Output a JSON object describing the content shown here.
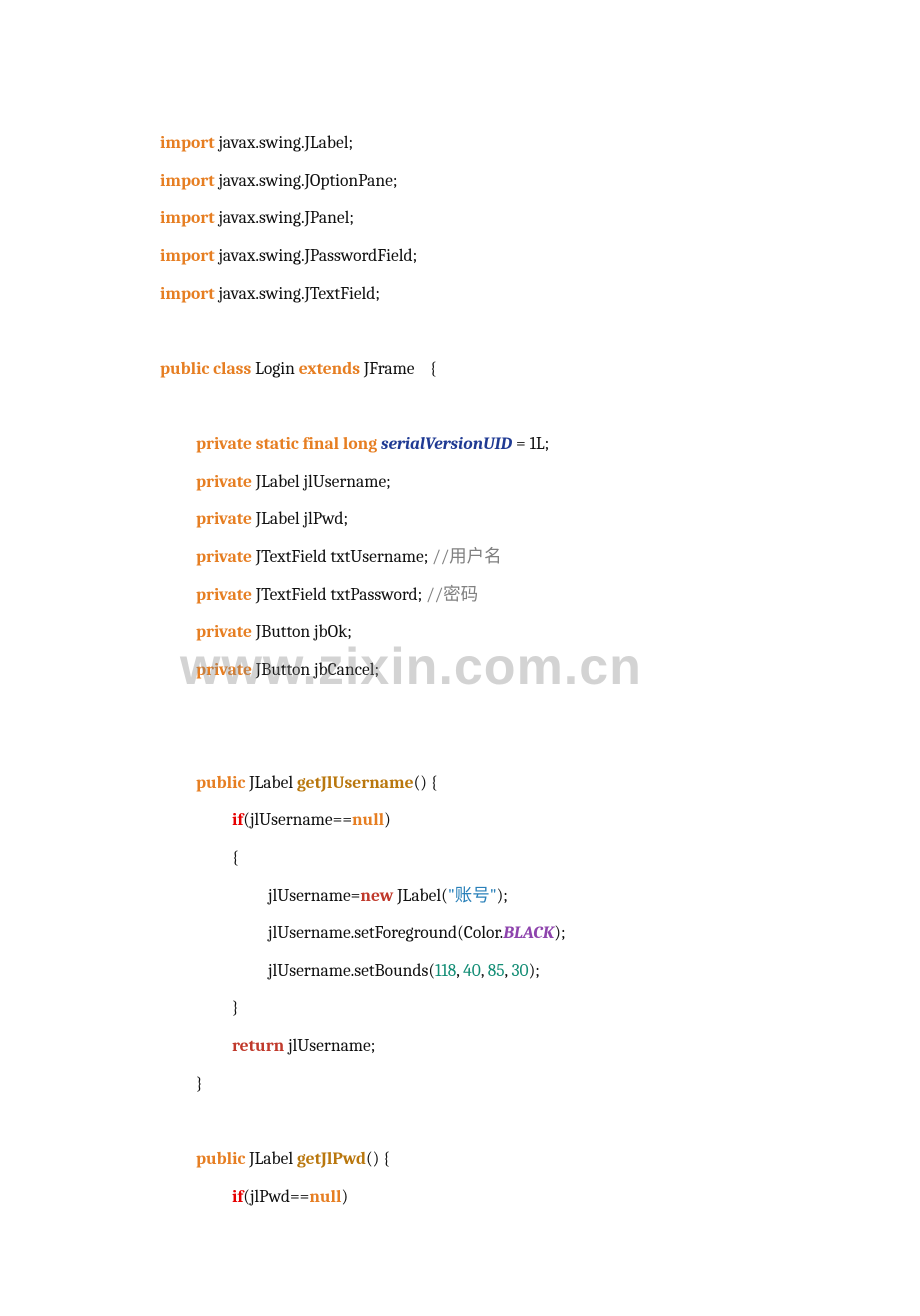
{
  "watermark": "www.zixin.com.cn",
  "lines": [
    {
      "indent": 0,
      "spans": [
        {
          "cls": "kw-orange",
          "t": "import"
        },
        {
          "cls": "txt-black",
          "t": " javax.swing.JLabel;"
        }
      ]
    },
    {
      "indent": 0,
      "spans": [
        {
          "cls": "kw-orange",
          "t": "import"
        },
        {
          "cls": "txt-black",
          "t": " javax.swing.JOptionPane;"
        }
      ]
    },
    {
      "indent": 0,
      "spans": [
        {
          "cls": "kw-orange",
          "t": "import"
        },
        {
          "cls": "txt-black",
          "t": " javax.swing.JPanel;"
        }
      ]
    },
    {
      "indent": 0,
      "spans": [
        {
          "cls": "kw-orange",
          "t": "import"
        },
        {
          "cls": "txt-black",
          "t": " javax.swing.JPasswordField;"
        }
      ]
    },
    {
      "indent": 0,
      "spans": [
        {
          "cls": "kw-orange",
          "t": "import"
        },
        {
          "cls": "txt-black",
          "t": " javax.swing.JTextField;"
        }
      ]
    },
    {
      "blank": true
    },
    {
      "indent": 0,
      "spans": [
        {
          "cls": "kw-orange",
          "t": "public class"
        },
        {
          "cls": "txt-black",
          "t": " Login "
        },
        {
          "cls": "kw-orange",
          "t": "extends"
        },
        {
          "cls": "txt-black",
          "t": " JFrame    {"
        }
      ]
    },
    {
      "blank": true
    },
    {
      "indent": 1,
      "spans": [
        {
          "cls": "kw-orange",
          "t": "private static final long"
        },
        {
          "cls": "txt-black",
          "t": " "
        },
        {
          "cls": "txt-blue-i",
          "t": "serialVersionUID"
        },
        {
          "cls": "txt-black",
          "t": " = 1L;"
        }
      ]
    },
    {
      "indent": 1,
      "spans": [
        {
          "cls": "kw-orange",
          "t": "private"
        },
        {
          "cls": "txt-black",
          "t": " JLabel jlUsername;"
        }
      ]
    },
    {
      "indent": 1,
      "spans": [
        {
          "cls": "kw-orange",
          "t": "private"
        },
        {
          "cls": "txt-black",
          "t": " JLabel jlPwd;"
        }
      ]
    },
    {
      "indent": 1,
      "spans": [
        {
          "cls": "kw-orange",
          "t": "private"
        },
        {
          "cls": "txt-black",
          "t": " JTextField txtUsername; "
        },
        {
          "cls": "txt-gray",
          "t": "//用户名"
        }
      ]
    },
    {
      "indent": 1,
      "spans": [
        {
          "cls": "kw-orange",
          "t": "private"
        },
        {
          "cls": "txt-black",
          "t": " JTextField txtPassword; "
        },
        {
          "cls": "txt-gray",
          "t": "//密码"
        }
      ]
    },
    {
      "indent": 1,
      "spans": [
        {
          "cls": "kw-orange",
          "t": "private"
        },
        {
          "cls": "txt-black",
          "t": " JButton jbOk;"
        }
      ]
    },
    {
      "indent": 1,
      "spans": [
        {
          "cls": "kw-orange",
          "t": "private"
        },
        {
          "cls": "txt-black",
          "t": " JButton jbCancel;"
        }
      ]
    },
    {
      "blank": true
    },
    {
      "blank": true
    },
    {
      "indent": 1,
      "spans": [
        {
          "cls": "kw-orange",
          "t": "public"
        },
        {
          "cls": "txt-black",
          "t": " JLabel "
        },
        {
          "cls": "txt-method",
          "t": "getJlUsername"
        },
        {
          "cls": "txt-black",
          "t": "() {"
        }
      ]
    },
    {
      "indent": 2,
      "spans": [
        {
          "cls": "kw-redbright",
          "t": "if"
        },
        {
          "cls": "txt-black",
          "t": "(jlUsername=="
        },
        {
          "cls": "kw-orange",
          "t": "null"
        },
        {
          "cls": "txt-black",
          "t": ")"
        }
      ]
    },
    {
      "indent": 2,
      "spans": [
        {
          "cls": "txt-black",
          "t": "{"
        }
      ]
    },
    {
      "indent": 3,
      "spans": [
        {
          "cls": "txt-black",
          "t": "jlUsername="
        },
        {
          "cls": "kw-red",
          "t": "new"
        },
        {
          "cls": "txt-black",
          "t": " JLabel("
        },
        {
          "cls": "txt-blue",
          "t": "\"账号\""
        },
        {
          "cls": "txt-black",
          "t": ");"
        }
      ]
    },
    {
      "indent": 3,
      "spans": [
        {
          "cls": "txt-black",
          "t": "jlUsername.setForeground(Color."
        },
        {
          "cls": "txt-purple",
          "t": "BLACK"
        },
        {
          "cls": "txt-black",
          "t": ");"
        }
      ]
    },
    {
      "indent": 3,
      "spans": [
        {
          "cls": "txt-black",
          "t": "jlUsername.setBounds("
        },
        {
          "cls": "txt-teal",
          "t": "118"
        },
        {
          "cls": "txt-black",
          "t": ", "
        },
        {
          "cls": "txt-teal",
          "t": "40"
        },
        {
          "cls": "txt-black",
          "t": ", "
        },
        {
          "cls": "txt-teal",
          "t": "85"
        },
        {
          "cls": "txt-black",
          "t": ", "
        },
        {
          "cls": "txt-teal",
          "t": "30"
        },
        {
          "cls": "txt-black",
          "t": ");"
        }
      ]
    },
    {
      "indent": 2,
      "spans": [
        {
          "cls": "txt-black",
          "t": "}"
        }
      ]
    },
    {
      "indent": 2,
      "spans": [
        {
          "cls": "kw-red",
          "t": "return"
        },
        {
          "cls": "txt-black",
          "t": " jlUsername;"
        }
      ]
    },
    {
      "indent": 1,
      "spans": [
        {
          "cls": "txt-black",
          "t": "}"
        }
      ]
    },
    {
      "blank": true
    },
    {
      "indent": 1,
      "spans": [
        {
          "cls": "kw-orange",
          "t": "public"
        },
        {
          "cls": "txt-black",
          "t": " JLabel "
        },
        {
          "cls": "txt-method",
          "t": "getJlPwd"
        },
        {
          "cls": "txt-black",
          "t": "() {"
        }
      ]
    },
    {
      "indent": 2,
      "spans": [
        {
          "cls": "kw-redbright",
          "t": "if"
        },
        {
          "cls": "txt-black",
          "t": "(jlPwd=="
        },
        {
          "cls": "kw-orange",
          "t": "null"
        },
        {
          "cls": "txt-black",
          "t": ")"
        }
      ]
    }
  ]
}
